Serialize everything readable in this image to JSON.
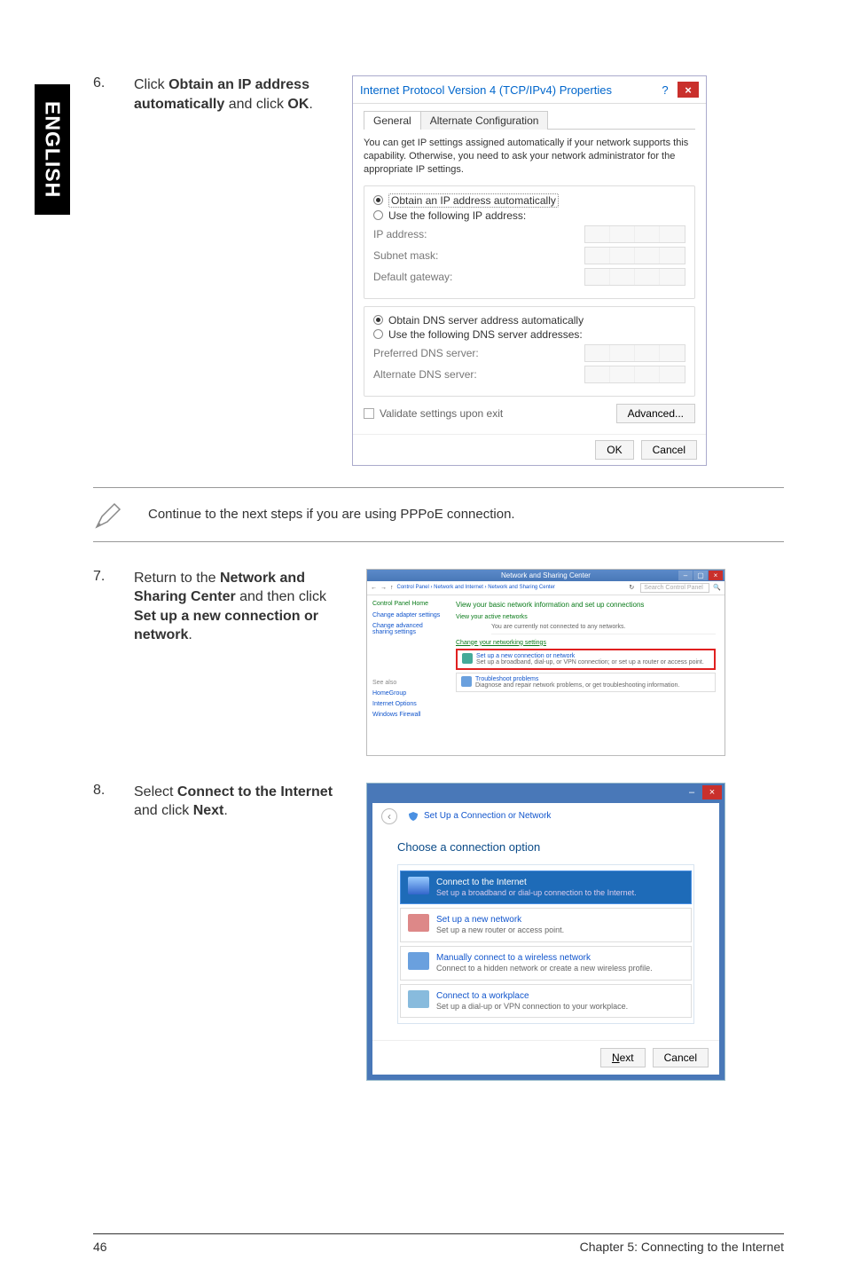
{
  "side_tab": "ENGLISH",
  "step6": {
    "num": "6.",
    "text_pre": "Click ",
    "text_b1": "Obtain an IP address automatically",
    "text_mid": " and click ",
    "text_b2": "OK",
    "text_post": "."
  },
  "tcp": {
    "title": "Internet Protocol Version 4 (TCP/IPv4) Properties",
    "help": "?",
    "close": "×",
    "tab_general": "General",
    "tab_alt": "Alternate Configuration",
    "desc": "You can get IP settings assigned automatically if your network supports this capability. Otherwise, you need to ask your network administrator for the appropriate IP settings.",
    "opt_auto_ip": "Obtain an IP address automatically",
    "opt_use_ip": "Use the following IP address:",
    "lbl_ip": "IP address:",
    "lbl_subnet": "Subnet mask:",
    "lbl_gateway": "Default gateway:",
    "opt_auto_dns": "Obtain DNS server address automatically",
    "opt_use_dns": "Use the following DNS server addresses:",
    "lbl_pref_dns": "Preferred DNS server:",
    "lbl_alt_dns": "Alternate DNS server:",
    "lbl_validate": "Validate settings upon exit",
    "btn_adv": "Advanced...",
    "btn_ok": "OK",
    "btn_cancel": "Cancel"
  },
  "note": "Continue to the next steps if you are using PPPoE connection.",
  "step7": {
    "num": "7.",
    "text_pre": "Return to the ",
    "text_b1": "Network and Sharing Center",
    "text_mid": " and then click ",
    "text_b2": "Set up a new connection or network",
    "text_post": "."
  },
  "nsc": {
    "title": "Network and Sharing Center",
    "addr": "Control Panel  ›  Network and Internet  ›  Network and Sharing Center",
    "refresh": "↻",
    "search_ph": "Search Control Panel",
    "side_home": "Control Panel Home",
    "side_adapter": "Change adapter settings",
    "side_sharing": "Change advanced sharing settings",
    "seealso": "See also",
    "side_homegroup": "HomeGroup",
    "side_inet": "Internet Options",
    "side_fw": "Windows Firewall",
    "h_basic": "View your basic network information and set up connections",
    "h_active": "View your active networks",
    "no_conn": "You are currently not connected to any networks.",
    "h_change": "Change your networking settings",
    "link_newconn_t": "Set up a new connection or network",
    "link_newconn_s": "Set up a broadband, dial-up, or VPN connection; or set up a router or access point.",
    "link_trouble_t": "Troubleshoot problems",
    "link_trouble_s": "Diagnose and repair network problems, or get troubleshooting information."
  },
  "step8": {
    "num": "8.",
    "text_pre": "Select ",
    "text_b1": "Connect to the Internet",
    "text_mid": " and click ",
    "text_b2": "Next",
    "text_post": "."
  },
  "wiz": {
    "close": "×",
    "bar_title": "Set Up a Connection or Network",
    "back": "‹",
    "heading": "Choose a connection option",
    "opt1_t": "Connect to the Internet",
    "opt1_s": "Set up a broadband or dial-up connection to the Internet.",
    "opt2_t": "Set up a new network",
    "opt2_s": "Set up a new router or access point.",
    "opt3_t": "Manually connect to a wireless network",
    "opt3_s": "Connect to a hidden network or create a new wireless profile.",
    "opt4_t": "Connect to a workplace",
    "opt4_s": "Set up a dial-up or VPN connection to your workplace.",
    "btn_next": "Next",
    "btn_cancel": "Cancel"
  },
  "footer": {
    "page": "46",
    "chapter": "Chapter 5: Connecting to the Internet"
  }
}
